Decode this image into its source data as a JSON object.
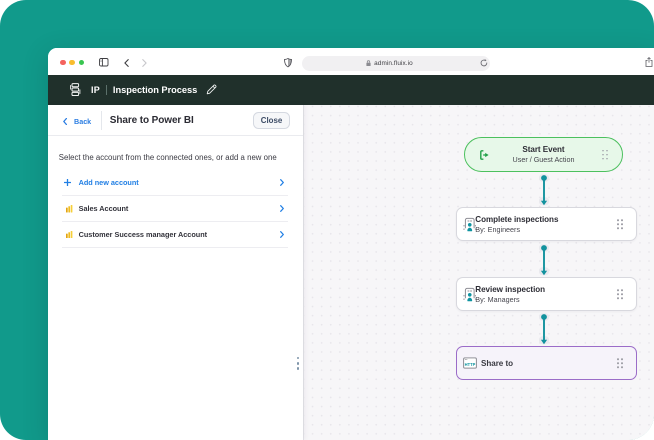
{
  "colors": {
    "stage_teal": "#119a8b",
    "appbar_dark": "#20302b",
    "accent_blue": "#217fe4",
    "arrow_teal": "#12929e",
    "start_green_border": "#4cc05e",
    "start_green_bg": "#e7f8e9",
    "http_purple_border": "#9b6cc8",
    "http_purple_bg": "#f6f3fa",
    "canvas_bg": "#f7f6f8"
  },
  "browser": {
    "traffic_lights": [
      "#f4635e",
      "#f9bd2e",
      "#39c550"
    ],
    "url": "admin.fluix.io",
    "icons": [
      "sidebar-icon",
      "back-icon",
      "forward-icon",
      "shield-icon",
      "lock-icon",
      "reload-icon",
      "share-icon"
    ]
  },
  "appbar": {
    "workflow_icon": "workflow-steps-icon",
    "initials": "IP",
    "title": "Inspection Process",
    "edit_icon": "pencil-icon"
  },
  "panel": {
    "back_label": "Back",
    "title": "Share to Power BI",
    "close_label": "Close",
    "instruction": "Select the account from the connected ones, or add a new one",
    "add_row": {
      "icon": "plus-icon",
      "label": "Add new account"
    },
    "accounts": [
      {
        "icon": "powerbi-icon",
        "label": "Sales Account"
      },
      {
        "icon": "powerbi-icon",
        "label": "Customer Success manager Account"
      }
    ]
  },
  "workflow": {
    "nodes": [
      {
        "type": "start",
        "icon": "start-event-icon",
        "title": "Start Event",
        "subtitle": "User / Guest Action"
      },
      {
        "type": "task",
        "icon": "assignee-icon",
        "title": "Complete inspections",
        "subtitle": "By: Engineers"
      },
      {
        "type": "task",
        "icon": "assignee-icon",
        "title": "Review inspection",
        "subtitle": "By: Managers"
      },
      {
        "type": "http",
        "icon": "http-icon",
        "icon_label": "HTTP",
        "title": "Share to"
      }
    ]
  }
}
